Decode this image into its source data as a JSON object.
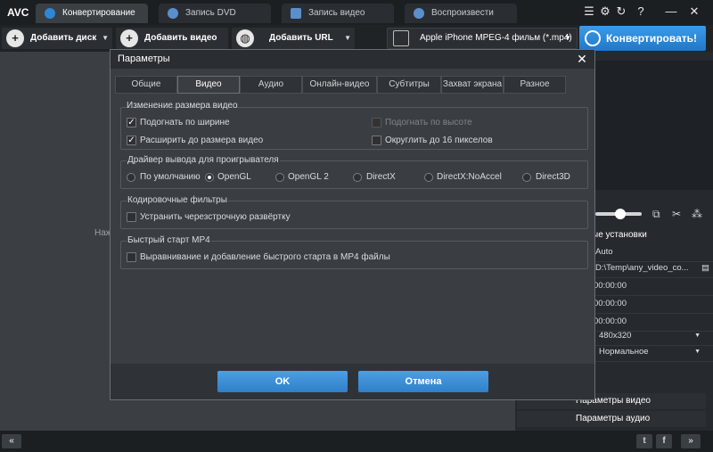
{
  "app": {
    "logo": "AVC"
  },
  "tabs": [
    {
      "label": "Конвертирование",
      "active": true
    },
    {
      "label": "Запись DVD"
    },
    {
      "label": "Запись видео"
    },
    {
      "label": "Воспроизвести"
    }
  ],
  "window_buttons": [
    "☰",
    "⚙",
    "↻",
    "?",
    "—",
    "✕"
  ],
  "toolbar": {
    "add_disc": "Добавить диск",
    "add_video": "Добавить видео",
    "add_url": "Добавить URL",
    "format": "Apple iPhone MPEG-4 фильм (*.mp4)",
    "convert": "Конвертировать!"
  },
  "main": {
    "hint_text": "Наж"
  },
  "right_panel": {
    "header": "ые установки",
    "rows": [
      {
        "value": "Auto"
      },
      {
        "value": "D:\\Temp\\any_video_co..."
      },
      {
        "value": "00:00:00"
      },
      {
        "value": "00:00:00"
      },
      {
        "value": "00:00:00"
      },
      {
        "value": "480x320"
      },
      {
        "value": "Нормальное"
      }
    ],
    "video_params": "Параметры видео",
    "audio_params": "Параметры аудио"
  },
  "status": {
    "left_btn": "«",
    "right_btn": "»"
  },
  "dialog": {
    "title": "Параметры",
    "tabs": [
      "Общие",
      "Видео",
      "Аудио",
      "Онлайн-видео",
      "Субтитры",
      "Захват экрана",
      "Разное"
    ],
    "active_tab": "Видео",
    "resize_group": {
      "title": "Изменение размера видео",
      "fit_width": {
        "label": "Подогнать по ширине",
        "checked": true
      },
      "fit_height": {
        "label": "Подогнать по высоте",
        "checked": false,
        "disabled": true
      },
      "expand": {
        "label": "Расширить до размера видео",
        "checked": true
      },
      "round16": {
        "label": "Округлить до 16 пикселов",
        "checked": false
      }
    },
    "driver_group": {
      "title": "Драйвер вывода для проигрывателя",
      "options": [
        "По умолчанию",
        "OpenGL",
        "OpenGL 2",
        "DirectX",
        "DirectX:NoAccel",
        "Direct3D"
      ],
      "selected": "OpenGL"
    },
    "filters_group": {
      "title": "Кодировочные фильтры",
      "deinterlace": {
        "label": "Устранить черезстрочную развёртку",
        "checked": false
      }
    },
    "mp4_group": {
      "title": "Быстрый старт MP4",
      "faststart": {
        "label": "Выравнивание и добавление быстрого старта в MP4 файлы",
        "checked": false
      }
    },
    "ok": "OK",
    "cancel": "Отмена"
  }
}
